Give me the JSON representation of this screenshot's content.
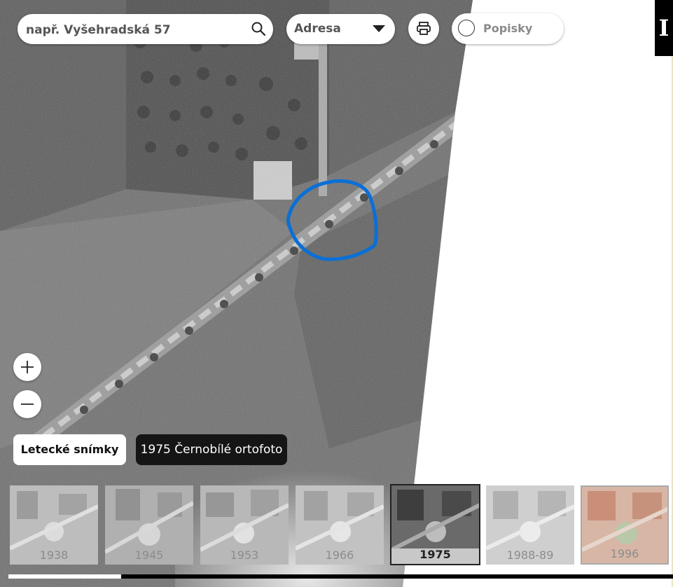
{
  "search": {
    "placeholder": "např. Vyšehradská 57",
    "icon": "search-icon"
  },
  "mode_select": {
    "selected": "Adresa",
    "icon": "chevron-down-icon"
  },
  "print": {
    "icon": "print-icon"
  },
  "labels_toggle": {
    "label": "Popisky",
    "checked": false
  },
  "info": {
    "label": "I"
  },
  "zoom": {
    "in_icon": "plus-icon",
    "out_icon": "minus-icon"
  },
  "layer_button": {
    "label": "Letecké snímky"
  },
  "current_layer": {
    "label": "1975 Černobílé ortofoto"
  },
  "timeline": {
    "items": [
      {
        "year": "1938"
      },
      {
        "year": "1945"
      },
      {
        "year": "1953"
      },
      {
        "year": "1966"
      },
      {
        "year": "1975"
      },
      {
        "year": "1988-89"
      },
      {
        "year": "1996"
      }
    ],
    "active_index": 4
  },
  "colors": {
    "marker": "#0a6fd6",
    "dark": "#151515"
  }
}
